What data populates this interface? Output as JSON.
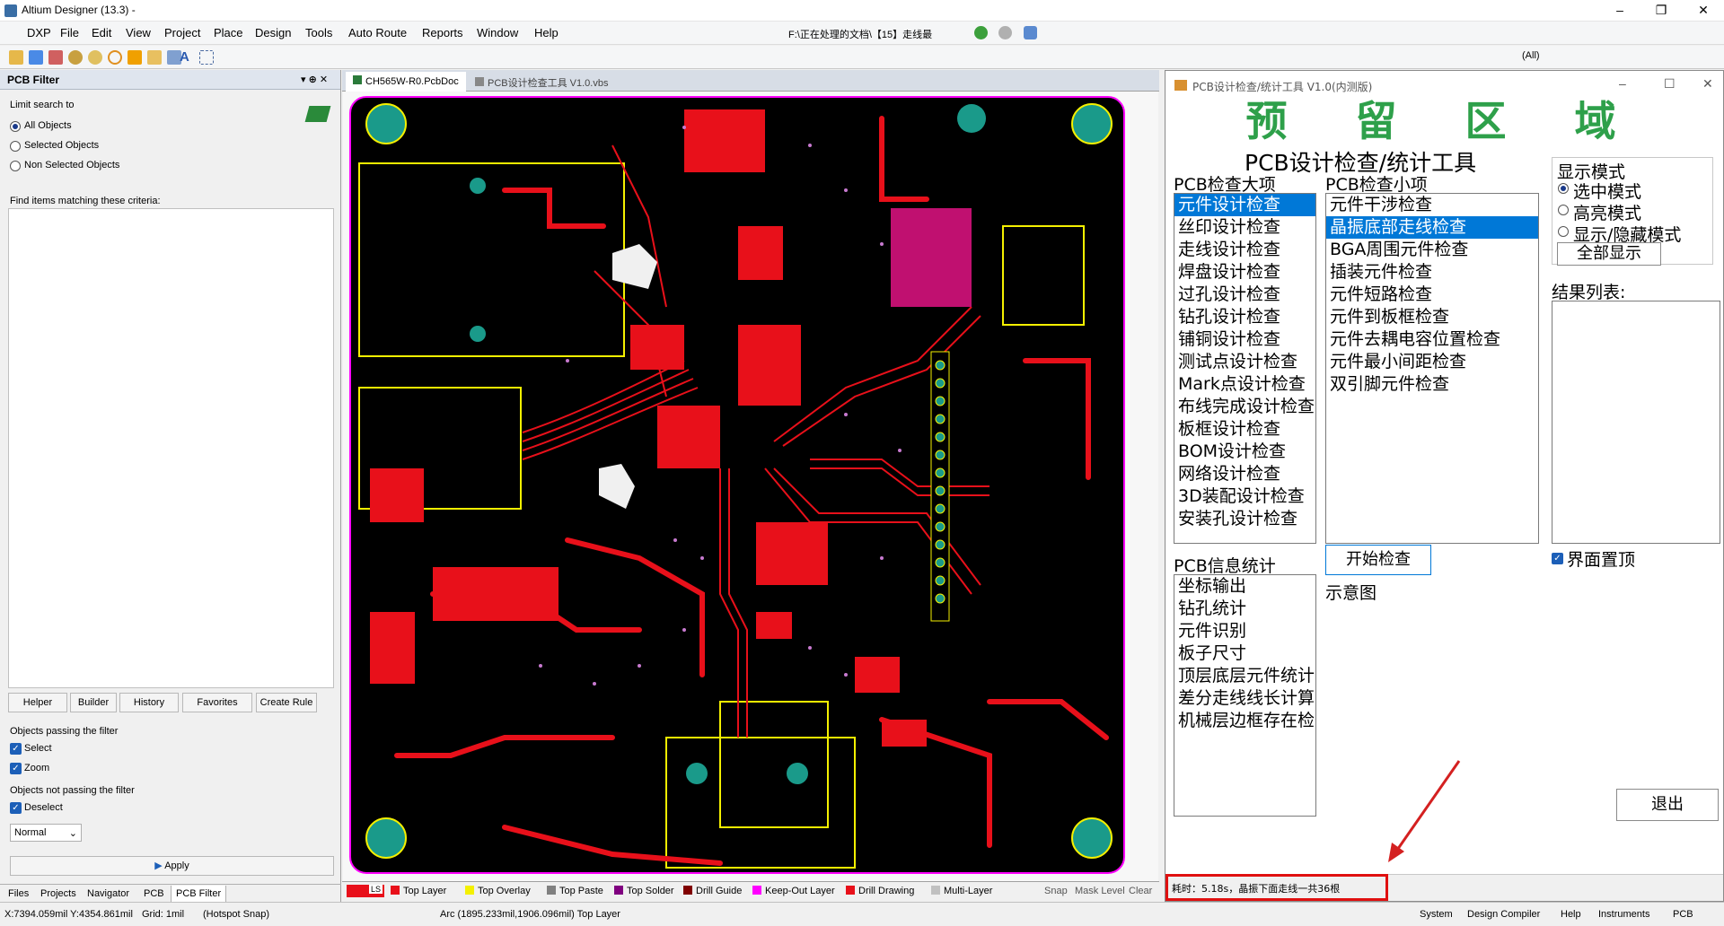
{
  "window": {
    "title": "Altium Designer (13.3) -",
    "min": "–",
    "max": "❐",
    "close": "✕"
  },
  "menu": [
    "DXP",
    "File",
    "Edit",
    "View",
    "Project",
    "Place",
    "Design",
    "Tools",
    "Auto Route",
    "Reports",
    "Window",
    "Help"
  ],
  "path_field": "F:\\正在处理的文档\\【15】走线最",
  "all_dropdown": "(All)",
  "pcb_filter": {
    "title": "PCB Filter",
    "limit_label": "Limit search to",
    "scope": [
      "All Objects",
      "Selected Objects",
      "Non Selected Objects"
    ],
    "find_label": "Find items matching these criteria:",
    "buttons": [
      "Helper",
      "Builder",
      "History",
      "Favorites",
      "Create Rule"
    ],
    "passing_label": "Objects passing the filter",
    "select": "Select",
    "zoom": "Zoom",
    "not_passing_label": "Objects not passing the filter",
    "deselect": "Deselect",
    "mode": "Normal",
    "apply": "Apply",
    "bottom_tabs": [
      "Files",
      "Projects",
      "Navigator",
      "PCB",
      "PCB Filter"
    ]
  },
  "doc_tabs": [
    "CH565W-R0.PcbDoc",
    "PCB设计检查工具 V1.0.vbs"
  ],
  "layers": {
    "ls": "LS",
    "items": [
      {
        "name": "Top Layer",
        "color": "#e8101a"
      },
      {
        "name": "Top Overlay",
        "color": "#f4f000"
      },
      {
        "name": "Top Paste",
        "color": "#808080"
      },
      {
        "name": "Top Solder",
        "color": "#800080"
      },
      {
        "name": "Drill Guide",
        "color": "#800000"
      },
      {
        "name": "Keep-Out Layer",
        "color": "#ff00ff"
      },
      {
        "name": "Drill Drawing",
        "color": "#e8101a"
      },
      {
        "name": "Multi-Layer",
        "color": "#c0c0c0"
      }
    ],
    "snap": "Snap",
    "mask": "Mask Level",
    "clear": "Clear"
  },
  "status": {
    "coords": "X:7394.059mil Y:4354.861mil",
    "grid": "Grid: 1mil",
    "snap": "(Hotspot Snap)",
    "object": "Arc (1895.233mil,1906.096mil) Top Layer",
    "tabs": [
      "System",
      "Design Compiler",
      "Help",
      "Instruments",
      "PCB"
    ]
  },
  "tool": {
    "title": "PCB设计检查/统计工具 V1.0(内测版)",
    "reserve": "预 留 区 域",
    "heading": "PCB设计检查/统计工具",
    "major_label": "PCB检查大项",
    "major": [
      "元件设计检查",
      "丝印设计检查",
      "走线设计检查",
      "焊盘设计检查",
      "过孔设计检查",
      "钻孔设计检查",
      "铺铜设计检查",
      "测试点设计检查",
      "Mark点设计检查",
      "布线完成设计检查",
      "板框设计检查",
      "BOM设计检查",
      "网络设计检查",
      "3D装配设计检查",
      "安装孔设计检查"
    ],
    "minor_label": "PCB检查小项",
    "minor": [
      "元件干涉检查",
      "晶振底部走线检查",
      "BGA周围元件检查",
      "插装元件检查",
      "元件短路检查",
      "元件到板框检查",
      "元件去耦电容位置检查",
      "元件最小间距检查",
      "双引脚元件检查"
    ],
    "display_label": "显示模式",
    "display": [
      "选中模式",
      "高亮模式",
      "显示/隐藏模式"
    ],
    "show_all": "全部显示",
    "result_label": "结果列表:",
    "on_top": "界面置顶",
    "start": "开始检查",
    "diagram": "示意图",
    "info_label": "PCB信息统计",
    "info": [
      "坐标输出",
      "钻孔统计",
      "元件识别",
      "板子尺寸",
      "顶层底层元件统计",
      "差分走线线长计算",
      "机械层边框存在检查"
    ],
    "exit": "退出",
    "status": "耗时：5.18s，晶振下面走线一共36根"
  }
}
